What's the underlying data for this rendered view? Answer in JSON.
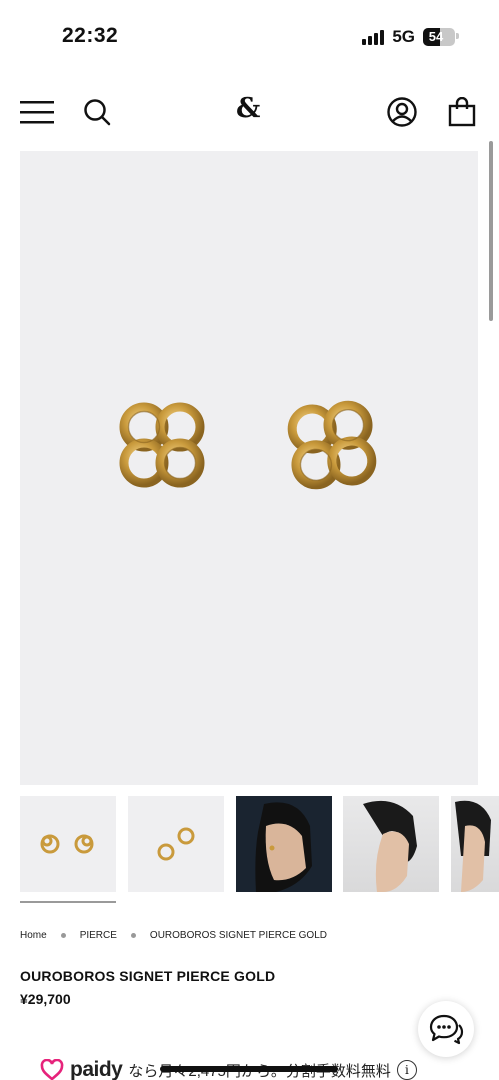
{
  "status_bar": {
    "time": "22:32",
    "network": "5G",
    "battery_level": "54"
  },
  "header": {
    "logo": "&",
    "icons": [
      "menu-icon",
      "search-icon",
      "account-icon",
      "bag-icon"
    ]
  },
  "gallery": {
    "main_image": "earrings-gold-pair",
    "thumbnails": [
      "earrings-front",
      "earrings-angled",
      "model-profile-left",
      "model-profile-right",
      "model-partial"
    ]
  },
  "breadcrumb": [
    "Home",
    "PIERCE",
    "OUROBOROS SIGNET PIERCE GOLD"
  ],
  "product": {
    "title": "OUROBOROS SIGNET PIERCE GOLD",
    "price": "¥29,700"
  },
  "paidy": {
    "logo": "paidy",
    "text": "なら月々2,475円から。分割手数料無料"
  },
  "colors": {
    "gold": "#c99a3c",
    "image_bg": "#efeff1",
    "paidy_pink": "#e6237b"
  }
}
